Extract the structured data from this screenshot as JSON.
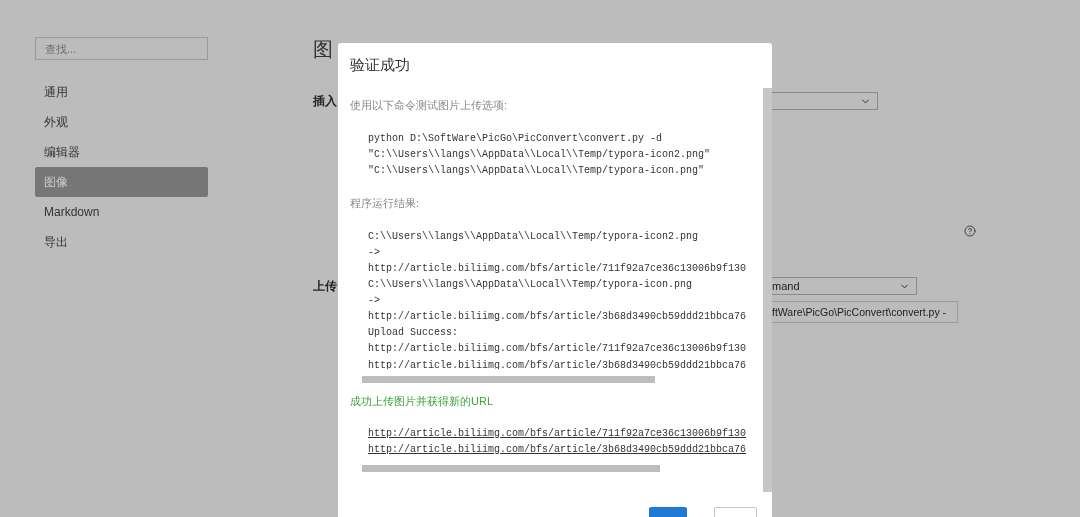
{
  "sidebar": {
    "search": {
      "placeholder": "查找..."
    },
    "items": [
      {
        "label": "通用",
        "selected": false
      },
      {
        "label": "外观",
        "selected": false
      },
      {
        "label": "编辑器",
        "selected": false
      },
      {
        "label": "图像",
        "selected": true
      },
      {
        "label": "Markdown",
        "selected": false
      },
      {
        "label": "导出",
        "selected": false
      }
    ]
  },
  "main": {
    "title": "图",
    "insert_label": "插入",
    "upload_label": "上传",
    "uploader_select": {
      "value": "mand"
    },
    "command_field": {
      "value": "ftWare\\PicGo\\PicConvert\\convert.py -"
    }
  },
  "dialog": {
    "title": "验证成功",
    "intro": "使用以下命令测试图片上传选项:",
    "command_lines": [
      "python D:\\SoftWare\\PicGo\\PicConvert\\convert.py -d",
      "\"C:\\\\Users\\\\langs\\\\AppData\\\\Local\\\\Temp/typora-icon2.png\"",
      "\"C:\\\\Users\\\\langs\\\\AppData\\\\Local\\\\Temp/typora-icon.png\""
    ],
    "result_label": "程序运行结果:",
    "result_lines": [
      "C:\\\\Users\\\\langs\\\\AppData\\\\Local\\\\Temp/typora-icon2.png",
      "->",
      "http://article.biliimg.com/bfs/article/711f92a7ce36c13006b9f130",
      "C:\\\\Users\\\\langs\\\\AppData\\\\Local\\\\Temp/typora-icon.png",
      "->",
      "http://article.biliimg.com/bfs/article/3b68d3490cb59ddd21bbca76",
      "Upload Success:",
      "http://article.biliimg.com/bfs/article/711f92a7ce36c13006b9f130",
      "http://article.biliimg.com/bfs/article/3b68d3490cb59ddd21bbca76"
    ],
    "success_text": "成功上传图片并获得新的URL",
    "urls": [
      "http://article.biliimg.com/bfs/article/711f92a7ce36c13006b9f130",
      "http://article.biliimg.com/bfs/article/3b68d3490cb59ddd21bbca76"
    ],
    "buttons": [
      {
        "kind": "primary"
      },
      {
        "kind": "secondary"
      }
    ]
  }
}
